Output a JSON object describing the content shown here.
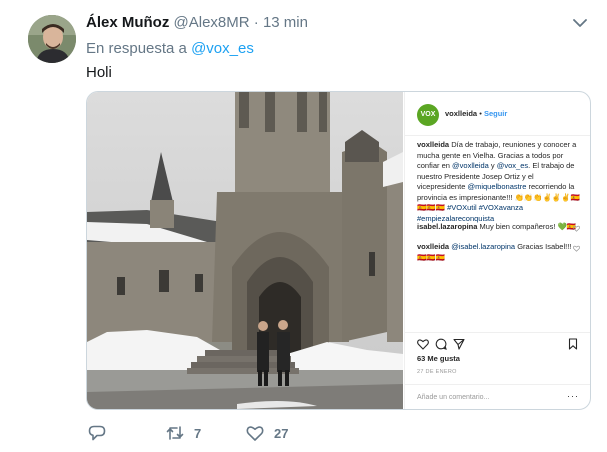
{
  "tweet": {
    "author_name": "Álex Muñoz",
    "author_handle": "@Alex8MR",
    "separator": "·",
    "time": "13 min",
    "reply_prefix": "En respuesta a",
    "reply_mention": "@vox_es",
    "text": "Holi"
  },
  "instagram": {
    "avatar_text": "VOX",
    "username": "voxlleida",
    "dot": "•",
    "follow_label": "Seguir",
    "caption_user": "voxlleida",
    "caption_part1": "Día de trabajo, reuniones y conocer a mucha gente en Vielha. Gracias a todos por confiar en",
    "caption_m1": "@voxlleida",
    "caption_and": "y",
    "caption_m2": "@vox_es",
    "caption_part2": ". El trabajo de nuestro Presidente Josep Ortiz y el vicepresidente",
    "caption_m3": "@miquelbonastre",
    "caption_part3": "recorriendo la provincia es impresionante!!! 👏👏👏✌️✌️✌️🇪🇸",
    "caption_flags": "🇪🇸🇪🇸🇪🇸",
    "caption_tags": "#VOXutil #VOXavanza #empiezalareconquista",
    "comment1_user": "isabel.lazaropina",
    "comment1_text": "Muy bien compañeros! 💚🇪🇸",
    "comment2_user": "voxlleida",
    "comment2_mention": "@isabel.lazaropina",
    "comment2_text": "Gracias Isabel!!! 🇪🇸🇪🇸🇪🇸",
    "likes": "63 Me gusta",
    "date": "27 DE ENERO",
    "comment_placeholder": "Añade un comentario...",
    "more": "···"
  },
  "actions": {
    "retweet_count": "7",
    "like_count": "27"
  },
  "icons": [
    "caret-down-icon",
    "reply-icon",
    "retweet-icon",
    "heart-icon",
    "comment-icon",
    "share-icon",
    "bookmark-icon"
  ],
  "colors": {
    "link": "#1da1f2",
    "muted": "#657786",
    "vox_green": "#5ba623",
    "ig_blue": "#3897f0"
  }
}
